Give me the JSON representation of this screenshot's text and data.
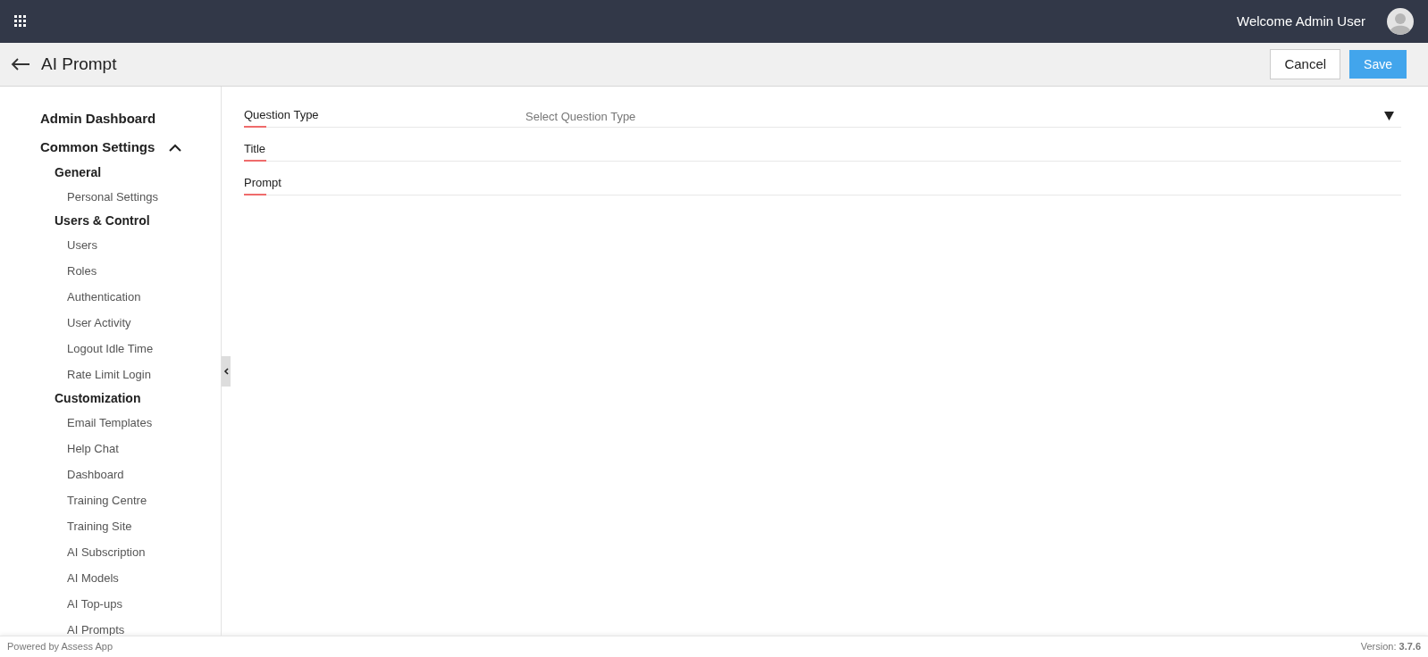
{
  "top_bar": {
    "welcome": "Welcome Admin User"
  },
  "header": {
    "title": "AI Prompt",
    "buttons": [
      {
        "label": "Cancel",
        "kind": "secondary"
      },
      {
        "label": "Save",
        "kind": "primary"
      }
    ]
  },
  "sidebar": {
    "items": [
      {
        "label": "Admin Dashboard"
      },
      {
        "label": "Common Settings",
        "expanded": true,
        "children": [
          {
            "label": "General",
            "children": [
              {
                "label": "Personal Settings"
              }
            ]
          },
          {
            "label": "Users & Control",
            "children": [
              {
                "label": "Users"
              },
              {
                "label": "Roles"
              },
              {
                "label": "Authentication"
              },
              {
                "label": "User Activity"
              },
              {
                "label": "Logout Idle Time"
              },
              {
                "label": "Rate Limit Login"
              }
            ]
          },
          {
            "label": "Customization",
            "children": [
              {
                "label": "Email Templates"
              },
              {
                "label": "Help Chat"
              },
              {
                "label": "Dashboard"
              },
              {
                "label": "Training Centre"
              },
              {
                "label": "Training Site"
              },
              {
                "label": "AI Subscription"
              },
              {
                "label": "AI Models"
              },
              {
                "label": "AI Top-ups"
              },
              {
                "label": "AI Prompts"
              }
            ]
          }
        ]
      }
    ]
  },
  "form": {
    "fields": [
      {
        "label": "Question Type",
        "kind": "select",
        "placeholder": "Select Question Type"
      },
      {
        "label": "Title",
        "kind": "text"
      },
      {
        "label": "Prompt",
        "kind": "text"
      }
    ]
  },
  "footer": {
    "left": "Powered by Assess App",
    "version": "Version: **3.7.6**"
  }
}
